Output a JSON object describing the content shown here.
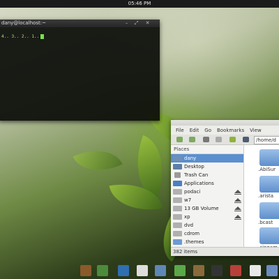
{
  "panel": {
    "clock": "05:46 PM"
  },
  "terminal": {
    "title": "dany@localhost:~",
    "prompt_line": "4.. 3.. 2.. 1.."
  },
  "file_manager": {
    "menu": [
      "File",
      "Edit",
      "Go",
      "Bookmarks",
      "View"
    ],
    "path": "/home/d",
    "places_header": "Places",
    "places": [
      {
        "label": "dany",
        "icon": "home-folder-icon",
        "selected": true,
        "eject": false
      },
      {
        "label": "Desktop",
        "icon": "desktop-icon",
        "selected": false,
        "eject": false
      },
      {
        "label": "Trash Can",
        "icon": "trash-icon",
        "selected": false,
        "eject": false
      },
      {
        "label": "Applications",
        "icon": "applications-icon",
        "selected": false,
        "eject": false
      },
      {
        "label": "podaci",
        "icon": "drive-icon",
        "selected": false,
        "eject": true
      },
      {
        "label": "w7",
        "icon": "drive-icon",
        "selected": false,
        "eject": true
      },
      {
        "label": "13 GB Volume",
        "icon": "drive-icon",
        "selected": false,
        "eject": true
      },
      {
        "label": "xp",
        "icon": "drive-icon",
        "selected": false,
        "eject": true
      },
      {
        "label": "dvd",
        "icon": "drive-icon",
        "selected": false,
        "eject": false
      },
      {
        "label": "cdrom",
        "icon": "drive-icon",
        "selected": false,
        "eject": false
      },
      {
        "label": ".themes",
        "icon": "folder-icon",
        "selected": false,
        "eject": false
      }
    ],
    "folders": [
      ".AbiSur",
      ".arista",
      ".bcast",
      ".cinnam"
    ],
    "status": "382 items"
  },
  "colors": {
    "selection": "#5a8fce",
    "terminal_text": "#b9e27a",
    "cursor": "#78e04a"
  }
}
